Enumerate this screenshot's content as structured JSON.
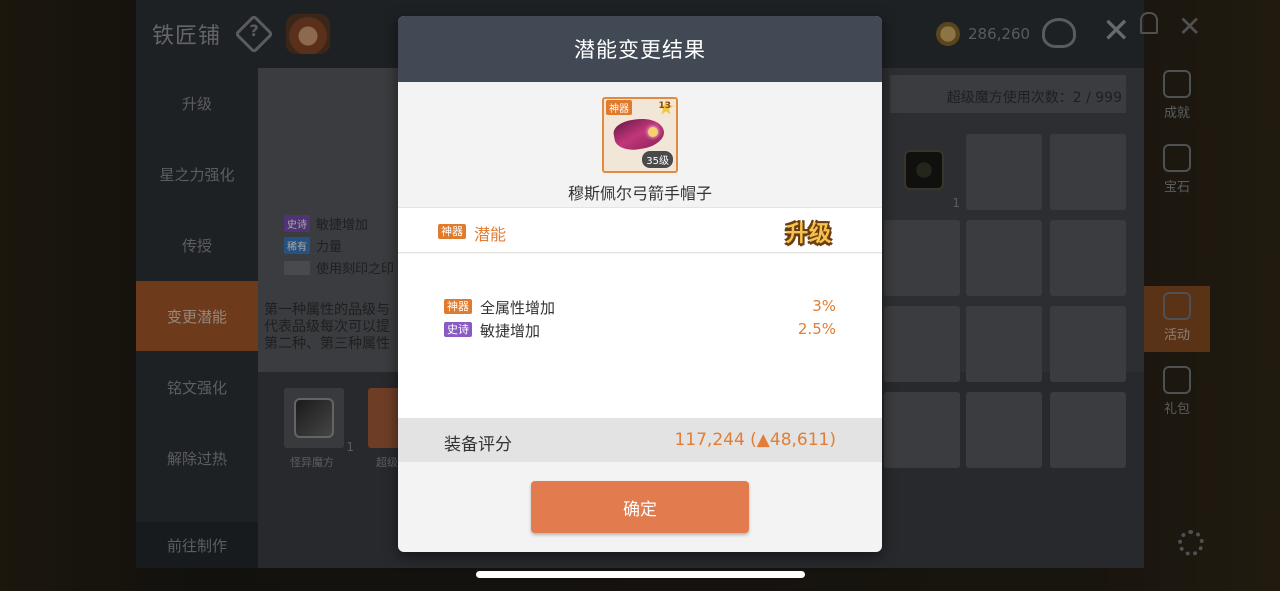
{
  "smithy": {
    "title": "铁匠铺",
    "coins": "286,260",
    "nav": [
      "升级",
      "星之力强化",
      "传授",
      "变更潜能",
      "铭文强化",
      "解除过热"
    ],
    "nav_active_index": 3,
    "nav_footer": "前往制作",
    "attr_lines": [
      {
        "tag": "史诗",
        "text": "敏捷增加"
      },
      {
        "tag": "稀有",
        "text": "力量"
      },
      {
        "tag": "",
        "text": "使用刻印之印"
      }
    ],
    "description": "第一种属性的品级与\n代表品级每次可以提\n第二种、第三种属性",
    "slots": [
      {
        "label": "怪异魔方",
        "count": "1"
      },
      {
        "label": "超级"
      }
    ],
    "super_cube_usage": "超级魔方使用次数：2 / 999",
    "grid_item_count": "1"
  },
  "right_rail": [
    "成就",
    "宝石",
    "活动",
    "礼包"
  ],
  "modal": {
    "title": "潜能变更结果",
    "item": {
      "grade": "神器",
      "stars": "13",
      "level": "35级",
      "name": "穆斯佩尔弓箭手帽子"
    },
    "potential_grade_tag": "神器",
    "potential_label": "潜能",
    "upgrade_badge": "升级",
    "stats": [
      {
        "tag": "神器",
        "name": "全属性增加",
        "value": "3%"
      },
      {
        "tag": "史诗",
        "name": "敏捷增加",
        "value": "2.5%"
      }
    ],
    "score_label": "装备评分",
    "score_value": "117,244 (▲48,611)",
    "confirm_label": "确定"
  },
  "colors": {
    "header": "#414954",
    "accent_orange": "#e27d35",
    "confirm_button": "#e27b4d",
    "legendary_tag": "#e07a2c",
    "epic_tag": "#8a5ac4"
  }
}
